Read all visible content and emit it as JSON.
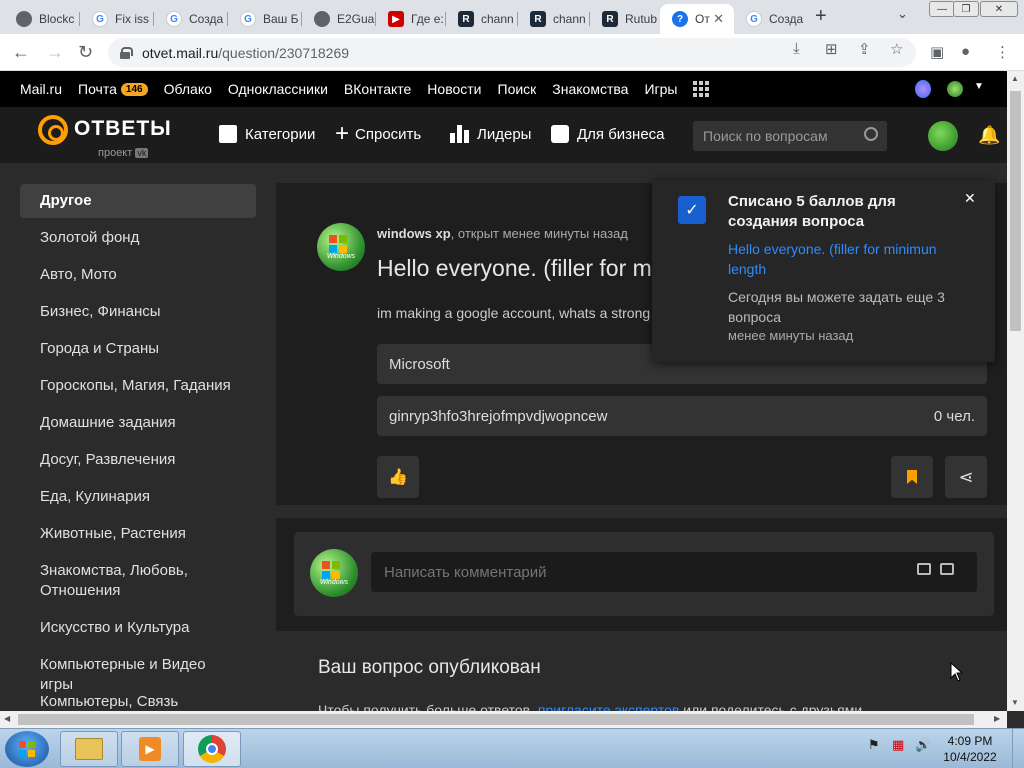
{
  "browser": {
    "tabs": [
      {
        "label": "Blockc",
        "icon": "globe-icon",
        "color": "#5f6368"
      },
      {
        "label": "Fix iss",
        "icon": "google-icon",
        "color": "#4285f4"
      },
      {
        "label": "Созда",
        "icon": "google-icon",
        "color": "#4285f4"
      },
      {
        "label": "Ваш Б",
        "icon": "google-icon",
        "color": "#4285f4"
      },
      {
        "label": "E2Gua",
        "icon": "globe-icon",
        "color": "#5f6368"
      },
      {
        "label": "Где е:",
        "icon": "youtube-icon",
        "color": "#cc0000"
      },
      {
        "label": "chann",
        "icon": "rutube-icon",
        "color": "#1c2a3a"
      },
      {
        "label": "chann",
        "icon": "rutube-icon",
        "color": "#1c2a3a"
      },
      {
        "label": "Rutub",
        "icon": "rutube-icon",
        "color": "#1c2a3a"
      },
      {
        "label": "От",
        "icon": "otvety-icon",
        "color": "#1a73e8"
      },
      {
        "label": "Созда",
        "icon": "google-icon",
        "color": "#4285f4"
      }
    ],
    "url_host": "otvet.mail.ru",
    "url_path": "/question/230718269"
  },
  "portal": {
    "items": [
      "Mail.ru",
      "Почта",
      "Облако",
      "Одноклассники",
      "ВКонтакте",
      "Новости",
      "Поиск",
      "Знакомства",
      "Игры"
    ],
    "mail_count": "146"
  },
  "header": {
    "logo_text": "ОТВЕТЫ",
    "logo_sub": "проект",
    "logo_sub_badge": "vk",
    "nav": [
      "Категории",
      "Спросить",
      "Лидеры",
      "Для бизнеса"
    ],
    "search_placeholder": "Поиск по вопросам"
  },
  "sidebar": {
    "categories": [
      "Другое",
      "Золотой фонд",
      "Авто, Мото",
      "Бизнес, Финансы",
      "Города и Страны",
      "Гороскопы, Магия, Гадания",
      "Домашние задания",
      "Досуг, Развлечения",
      "Еда, Кулинария",
      "Животные, Растения",
      "Знакомства, Любовь, Отношения",
      "Искусство и Культура",
      "Компьютерные и Видео игры",
      "Компьютеры, Связь"
    ]
  },
  "question": {
    "author": "windows xp",
    "meta": ", открыт менее минуты назад",
    "avatar_label": "Windows",
    "title": "Hello everyone. (filler for minimun length",
    "body": "im making a google account, whats a strong password",
    "options": [
      {
        "text": "Microsoft",
        "count": ""
      },
      {
        "text": "ginryp3hfo3hrejofmpvdjwopncew",
        "count": "0 чел."
      }
    ]
  },
  "comment": {
    "placeholder": "Написать комментарий",
    "avatar_label": "Windows"
  },
  "published": {
    "title": "Ваш вопрос опубликован",
    "text_before": "Чтобы получить больше ответов,",
    "text_link": "пригласите экспертов",
    "text_after": "или поделитесь с друзьями"
  },
  "notification": {
    "title": "Списано 5 баллов для создания вопроса",
    "link": "Hello everyone. (filler for minimun length",
    "subtitle": "Сегодня вы можете задать еще 3 вопроса",
    "time": "менее минуты назад"
  },
  "taskbar": {
    "time": "4:09 PM",
    "date": "10/4/2022"
  },
  "colors": {
    "accent_orange": "#ff9e00",
    "link_blue": "#2d8cff",
    "badge": "#f5a623"
  }
}
